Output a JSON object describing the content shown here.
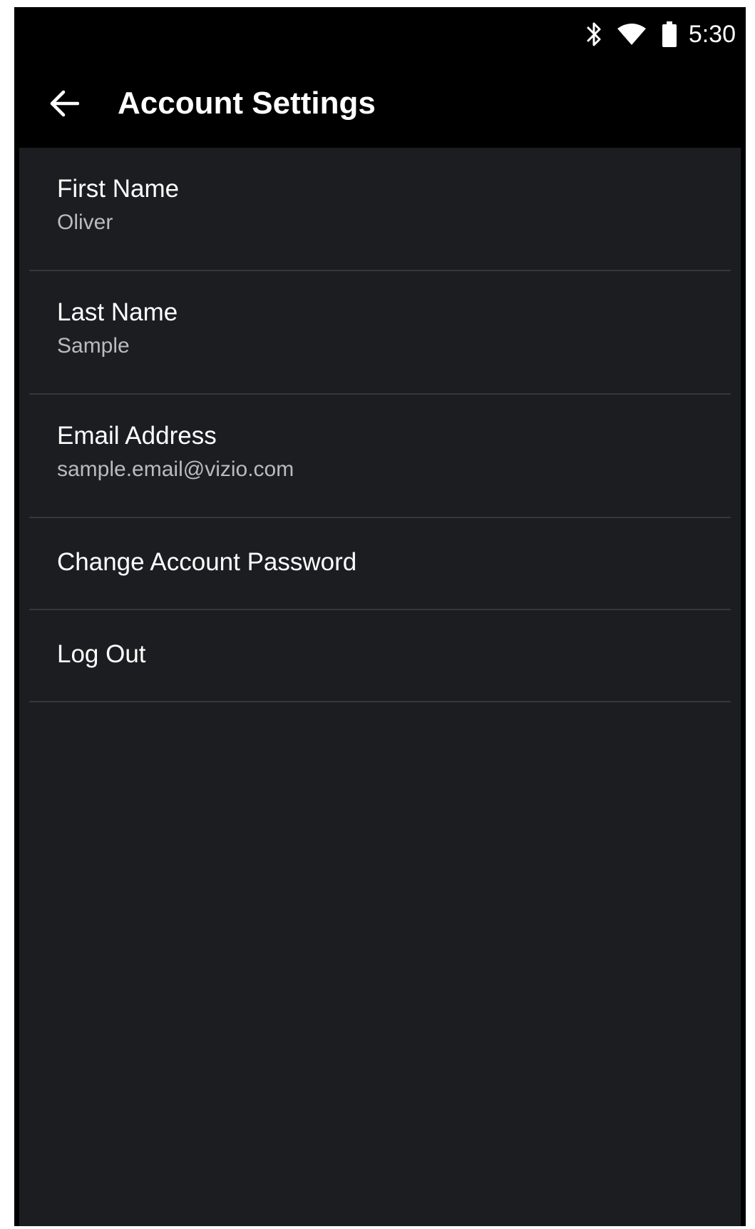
{
  "status_bar": {
    "time": "5:30",
    "icons": [
      "bluetooth-icon",
      "wifi-icon",
      "battery-icon"
    ]
  },
  "app_bar": {
    "back_icon": "arrow-left-icon",
    "title": "Account Settings"
  },
  "settings": {
    "first_name": {
      "label": "First Name",
      "value": "Oliver"
    },
    "last_name": {
      "label": "Last Name",
      "value": "Sample"
    },
    "email": {
      "label": "Email Address",
      "value": "sample.email@vizio.com"
    },
    "change_password": {
      "label": "Change Account Password"
    },
    "log_out": {
      "label": "Log Out"
    }
  },
  "colors": {
    "app_bar_background": "#000000",
    "content_background": "#1b1d20",
    "divider": "#34373b",
    "primary_text": "#ffffff",
    "secondary_text": "#b9bbbe"
  }
}
